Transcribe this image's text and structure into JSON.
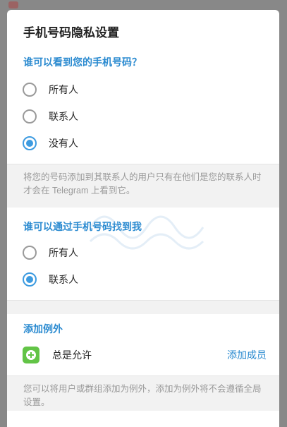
{
  "dialog": {
    "title": "手机号码隐私设置"
  },
  "see_number": {
    "title": "谁可以看到您的手机号码？",
    "options": [
      {
        "label": "所有人",
        "checked": false
      },
      {
        "label": "联系人",
        "checked": false
      },
      {
        "label": "没有人",
        "checked": true
      }
    ],
    "note": "将您的号码添加到其联系人的用户只有在他们是您的联系人时才会在 Telegram 上看到它。"
  },
  "find_number": {
    "title": "谁可以通过手机号码找到我",
    "options": [
      {
        "label": "所有人",
        "checked": false
      },
      {
        "label": "联系人",
        "checked": true
      }
    ]
  },
  "exceptions": {
    "title": "添加例外",
    "always_allow_label": "总是允许",
    "add_members_label": "添加成员",
    "note": "您可以将用户或群组添加为例外，添加为例外将不会遵循全局设置。"
  },
  "colors": {
    "accent": "#2a8ad0",
    "radio_checked": "#3d9be0",
    "plus_icon": "#62c446"
  }
}
